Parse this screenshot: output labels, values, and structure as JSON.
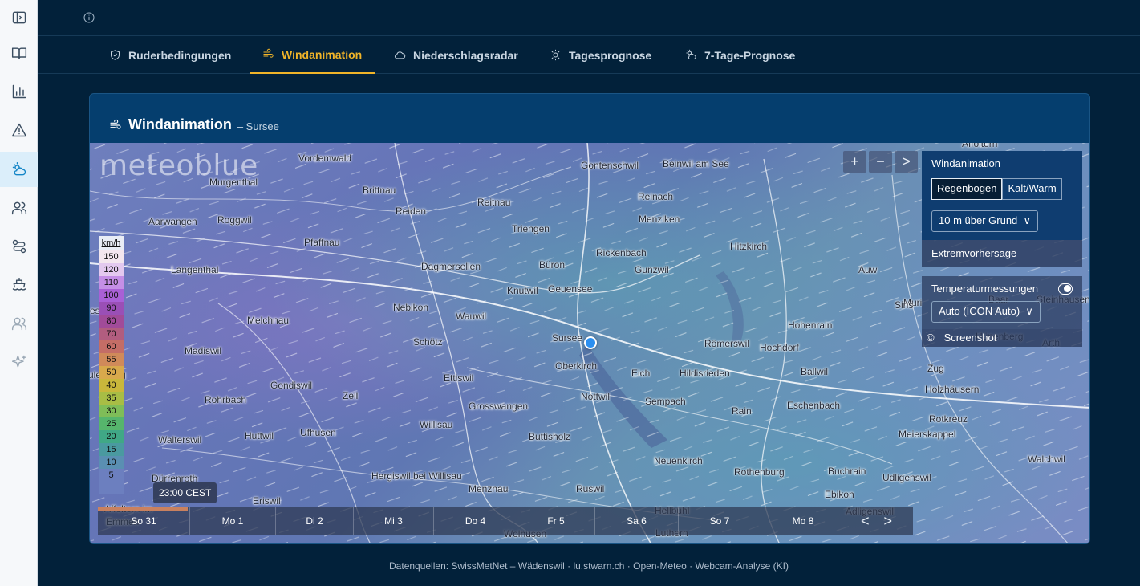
{
  "sidebar": {
    "items": [
      {
        "icon": "sidebar-toggle-icon"
      },
      {
        "icon": "book-icon"
      },
      {
        "icon": "bar-chart-icon"
      },
      {
        "icon": "warning-icon"
      },
      {
        "icon": "weather-cloud-icon",
        "active": true
      },
      {
        "icon": "users-icon"
      },
      {
        "icon": "route-icon"
      },
      {
        "icon": "boat-icon"
      },
      {
        "icon": "users-dim-icon"
      },
      {
        "icon": "sparkles-icon"
      }
    ]
  },
  "tabs": [
    {
      "label": "Ruderbedingungen",
      "icon": "shield-icon"
    },
    {
      "label": "Windanimation",
      "icon": "wind-icon",
      "active": true
    },
    {
      "label": "Niederschlagsradar",
      "icon": "cloud-icon"
    },
    {
      "label": "Tagesprognose",
      "icon": "sun-icon"
    },
    {
      "label": "7-Tage-Prognose",
      "icon": "sun-cloud-icon"
    }
  ],
  "card": {
    "title": "Windanimation",
    "subtitle": "– Sursee"
  },
  "map": {
    "logo": "meteoblue",
    "towns": [
      "Vordemwald",
      "Murgenthal",
      "Brittnau",
      "Reitnau",
      "Gontenschwil",
      "Beinwil am See",
      "Affoltern",
      "Reiden",
      "Reinach",
      "Aarwangen",
      "Roggwil",
      "Pfaffnau",
      "Triengen",
      "Menziken",
      "Langenthal",
      "Dagmersellen",
      "Büron",
      "Rickenbach",
      "Hitzkirch",
      "Gunzwil",
      "Auw",
      "Knutwil",
      "Geuensee",
      "Nebikon",
      "Wauwil",
      "Melchnau",
      "Sursee",
      "Römerswil",
      "Hohenrain",
      "Hochdorf",
      "Schötz",
      "Madiswil",
      "Oberkirch",
      "Eich",
      "Hildisrieden",
      "Ballwil",
      "Ettiswil",
      "Gondiswil",
      "Zell",
      "Nottwil",
      "Sempach",
      "Eschenbach",
      "Rohrbach",
      "Grosswangen",
      "Rain",
      "Willisau",
      "Huttwil",
      "Ufhusen",
      "Buttisholz",
      "Walterswil",
      "Neuenkirch",
      "Rothenburg",
      "Buchrain",
      "Udligenswil",
      "Dürrenroth",
      "Hergiswil bei Willisau",
      "Menznau",
      "Ruswil",
      "Ebikon",
      "Eriswil",
      "Emmen",
      "Hellbühl",
      "Adligenswil",
      "Luthern",
      "Wolhusen",
      "Muri",
      "Sins",
      "Hünenberg",
      "Zug",
      "Holzhäusern",
      "Rotkreuz",
      "Meierskappel",
      "Root",
      "Walchwil",
      "Arth",
      "Steinhausen",
      "Baar",
      "Affoltern im",
      "ulenberg",
      "esee",
      "Emm"
    ],
    "legend": {
      "unit": "km/h",
      "steps": [
        {
          "v": "150",
          "c": "#f3e6ee"
        },
        {
          "v": "120",
          "c": "#e3c9ef"
        },
        {
          "v": "110",
          "c": "#c48fe6"
        },
        {
          "v": "100",
          "c": "#a960d6"
        },
        {
          "v": "90",
          "c": "#9a4fb6"
        },
        {
          "v": "80",
          "c": "#a14b99"
        },
        {
          "v": "70",
          "c": "#b15d7f"
        },
        {
          "v": "60",
          "c": "#c46d66"
        },
        {
          "v": "55",
          "c": "#d08a5a"
        },
        {
          "v": "50",
          "c": "#d8a94c"
        },
        {
          "v": "40",
          "c": "#c9b73b"
        },
        {
          "v": "35",
          "c": "#a8bd45"
        },
        {
          "v": "30",
          "c": "#7fbd58"
        },
        {
          "v": "25",
          "c": "#56b56c"
        },
        {
          "v": "20",
          "c": "#40a886"
        },
        {
          "v": "15",
          "c": "#4a9aa0"
        },
        {
          "v": "10",
          "c": "#5a8fb2"
        },
        {
          "v": "5",
          "c": "#6c7fbf"
        }
      ]
    },
    "zoom": {
      "in": "+",
      "out": "−",
      "next": ">"
    },
    "controls": {
      "title": "Windanimation",
      "mode_options": [
        "Regenbogen",
        "Kalt/Warm"
      ],
      "height_select": "10 m über Grund",
      "extreme": "Extremvorhersage",
      "temperature": "Temperaturmessungen",
      "model_select": "Auto (ICON Auto)",
      "copyright": "©",
      "screenshot": "Screenshot"
    },
    "time": "23:00 CEST",
    "progress": 0.11,
    "days": [
      "So 31",
      "Mo 1",
      "Di 2",
      "Mi 3",
      "Do 4",
      "Fr 5",
      "Sa 6",
      "So 7",
      "Mo 8"
    ],
    "nav": {
      "prev": "<",
      "next": ">"
    }
  },
  "footer": "Datenquellen: SwissMetNet – Wädenswil · lu.stwarn.ch · Open-Meteo · Webcam-Analyse (KI)"
}
